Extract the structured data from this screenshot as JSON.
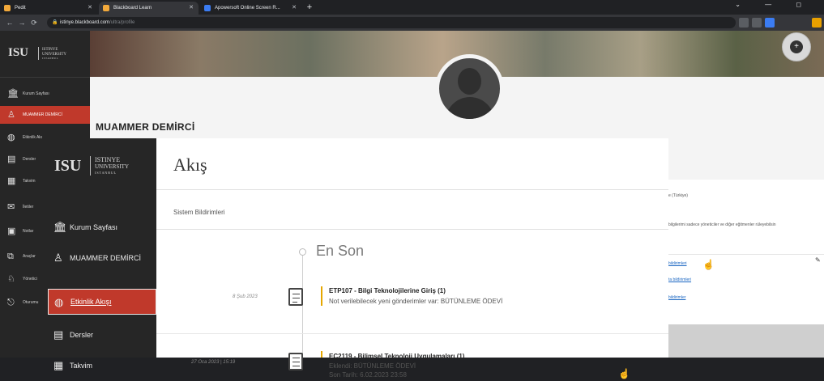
{
  "browser": {
    "tabs": [
      {
        "title": "Pedit",
        "favicon_color": "#f2a93b"
      },
      {
        "title": "Blackboard Learn",
        "favicon_color": "#f2a93b"
      },
      {
        "title": "Apowersoft Online Screen R...",
        "favicon_color": "#3b7cf2"
      }
    ],
    "url": "istinye.blackboard.com",
    "url_path": "/ultra/profile",
    "new_tab_label": "+",
    "window_controls": "⌄ — ◻"
  },
  "base_sidebar": {
    "logo": {
      "abbr": "ISU",
      "line1": "ISTINYE",
      "line2": "UNIVERSITY",
      "line3": "I S T A N B U L"
    },
    "items": [
      {
        "label": "Kurum Sayfası",
        "icon": "institution-icon"
      },
      {
        "label": "MUAMMER DEMİRCİ",
        "icon": "user-icon",
        "active": true
      },
      {
        "label": "Etkinlik Akı",
        "icon": "globe-icon"
      },
      {
        "label": "Dersler",
        "icon": "courses-icon"
      },
      {
        "label": "Takvim",
        "icon": "calendar-icon"
      },
      {
        "label": "İletiler",
        "icon": "messages-icon"
      },
      {
        "label": "Notlar",
        "icon": "grades-icon"
      },
      {
        "label": "Araçlar",
        "icon": "tools-icon"
      },
      {
        "label": "Yönetici",
        "icon": "admin-icon"
      },
      {
        "label": "Oturumu",
        "icon": "signout-icon"
      }
    ]
  },
  "profile": {
    "name": "MUAMMER DEMİRCİ"
  },
  "settings_panel": {
    "language": "e (Türkiye)",
    "privacy": "bilgilerimi sadece yöneticiler ve diğer eğitmenler rüleyebilsin",
    "links": [
      "bildirimleri",
      "ta bildirimleri",
      "bildirimler"
    ]
  },
  "overlay": {
    "logo": {
      "abbr": "ISU",
      "line1": "ISTINYE",
      "line2": "UNIVERSITY",
      "line3": "I S T A N B U L"
    },
    "nav": [
      {
        "label": "Kurum Sayfası",
        "icon": "institution-icon"
      },
      {
        "label": "MUAMMER DEMİRCİ",
        "icon": "user-icon"
      },
      {
        "label": "Etkinlik Akışı",
        "icon": "globe-icon",
        "active": true
      },
      {
        "label": "Dersler",
        "icon": "courses-icon"
      },
      {
        "label": "Takvim",
        "icon": "calendar-icon"
      }
    ],
    "title": "Akış",
    "notifications_label": "Sistem Bildirimleri",
    "section_label": "En Son",
    "feed": [
      {
        "date": "8 Şub 2023",
        "title": "ETP107 - Bilgi Teknolojilerine Giriş (1)",
        "subtitle": "Not verilebilecek yeni gönderimler var: BÜTÜNLEME ÖDEVİ",
        "icon": "grade-edit-icon"
      },
      {
        "date": "27 Oca 2023 | 15:19",
        "title": "EC2119 - Bilimsel Teknoloji Uygulamaları (1)",
        "subtitle": "Eklendi: BÜTÜNLEME ÖDEVİ",
        "extra": "Son Tarih: 6.02.2023 23:58",
        "icon": "assignment-list-icon"
      }
    ]
  }
}
